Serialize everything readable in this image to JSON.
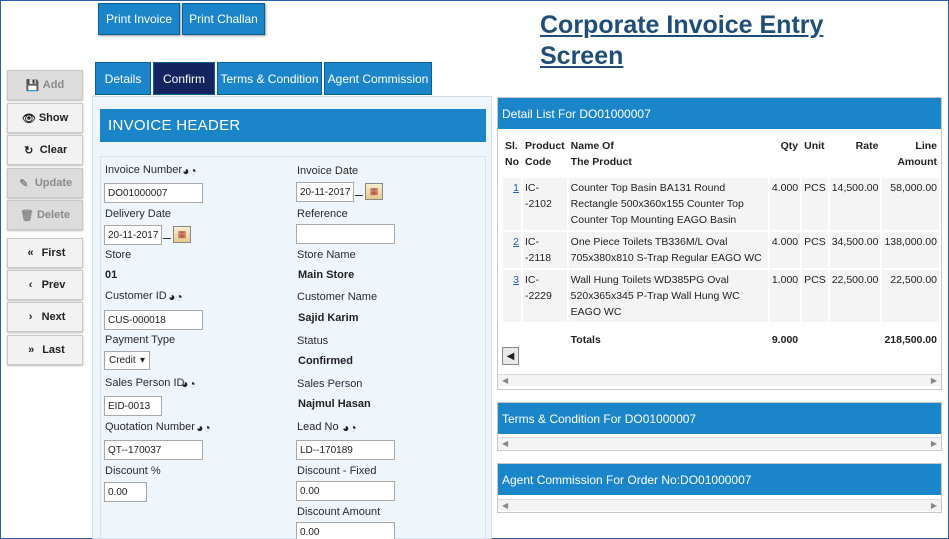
{
  "title": "Corporate Invoice Entry Screen",
  "top_buttons": {
    "print_invoice": "Print Invoice",
    "print_challan": "Print Challan"
  },
  "tabs": [
    {
      "label": "Details"
    },
    {
      "label": "Confirm"
    },
    {
      "label": "Terms & Condition"
    },
    {
      "label": "Agent Commission"
    }
  ],
  "sidebar": {
    "add": "Add",
    "show": "Show",
    "clear": "Clear",
    "update": "Update",
    "delete": "Delete",
    "first": "First",
    "prev": "Prev",
    "next": "Next",
    "last": "Last"
  },
  "form": {
    "header": "INVOICE HEADER",
    "invoice_number_label": "Invoice Number",
    "invoice_number": "DO01000007",
    "invoice_date_label": "Invoice Date",
    "invoice_date": "20-11-2017",
    "delivery_date_label": "Delivery Date",
    "delivery_date": "20-11-2017",
    "reference_label": "Reference",
    "reference": "",
    "store_label": "Store",
    "store": "01",
    "store_name_label": "Store Name",
    "store_name": "Main Store",
    "customer_id_label": "Customer ID",
    "customer_id": "CUS-000018",
    "customer_name_label": "Customer Name",
    "customer_name": "Sajid Karim",
    "payment_type_label": "Payment Type",
    "payment_type": "Credit",
    "status_label": "Status",
    "status": "Confirmed",
    "sales_person_id_label": "Sales Person ID",
    "sales_person_id": "EID-0013",
    "sales_person_label": "Sales Person",
    "sales_person": "Najmul Hasan",
    "quotation_number_label": "Quotation Number",
    "quotation_number": "QT--170037",
    "lead_no_label": "Lead No",
    "lead_no": "LD--170189",
    "discount_pct_label": "Discount %",
    "discount_pct": "0.00",
    "discount_fixed_label": "Discount - Fixed",
    "discount_fixed": "0.00",
    "discount_amount_label": "Discount Amount",
    "discount_amount": "0.00"
  },
  "detail": {
    "header": "Detail List For DO01000007",
    "columns": {
      "sl": "Sl.",
      "sl2": "No",
      "code": "Product",
      "code2": "Code",
      "name": "Name Of",
      "name2": "The Product",
      "qty": "Qty",
      "unit": "Unit",
      "rate": "Rate",
      "amount": "Line",
      "amount2": "Amount"
    },
    "rows": [
      {
        "sl": "1",
        "code": "IC--2102",
        "name": "Counter Top Basin BA131 Round Rectangle 500x360x155 Counter Top Counter Top Mounting EAGO Basin",
        "qty": "4.000",
        "unit": "PCS",
        "rate": "14,500.00",
        "amount": "58,000.00"
      },
      {
        "sl": "2",
        "code": "IC--2118",
        "name": "One Piece Toilets TB336M/L Oval 705x380x810 S-Trap Regular EAGO WC",
        "qty": "4.000",
        "unit": "PCS",
        "rate": "34,500.00",
        "amount": "138,000.00"
      },
      {
        "sl": "3",
        "code": "IC--2229",
        "name": "Wall Hung Toilets WD385PG Oval 520x365x345 P-Trap Wall Hung WC EAGO WC",
        "qty": "1.000",
        "unit": "PCS",
        "rate": "22,500.00",
        "amount": "22,500.00"
      }
    ],
    "totals_label": "Totals",
    "total_qty": "9.000",
    "total_amount": "218,500.00"
  },
  "terms": {
    "header": "Terms & Condition For DO01000007"
  },
  "agent": {
    "header": "Agent Commission For Order No:DO01000007"
  }
}
